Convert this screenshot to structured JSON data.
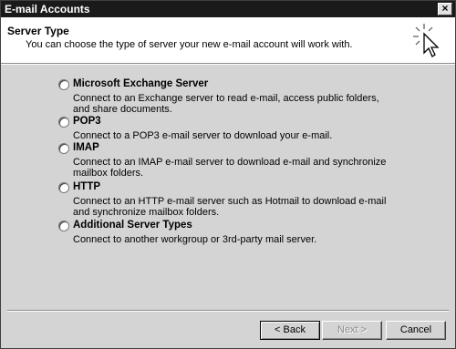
{
  "window": {
    "title": "E-mail Accounts",
    "close_glyph": "×"
  },
  "header": {
    "title": "Server Type",
    "subtitle": "You can choose the type of server your new e-mail account will work with.",
    "icon": "wizard-cursor-icon"
  },
  "options": [
    {
      "label": "Microsoft Exchange Server",
      "description": "Connect to an Exchange server to read e-mail, access public folders, and share documents.",
      "selected": false
    },
    {
      "label": "POP3",
      "description": "Connect to a POP3 e-mail server to download your e-mail.",
      "selected": false
    },
    {
      "label": "IMAP",
      "description": "Connect to an IMAP e-mail server to download e-mail and synchronize mailbox folders.",
      "selected": false
    },
    {
      "label": "HTTP",
      "description": "Connect to an HTTP e-mail server such as Hotmail to download e-mail and synchronize mailbox folders.",
      "selected": false
    },
    {
      "label": "Additional Server Types",
      "description": "Connect to another workgroup or 3rd-party mail server.",
      "selected": false
    }
  ],
  "buttons": {
    "back": "< Back",
    "next": "Next >",
    "cancel": "Cancel"
  }
}
